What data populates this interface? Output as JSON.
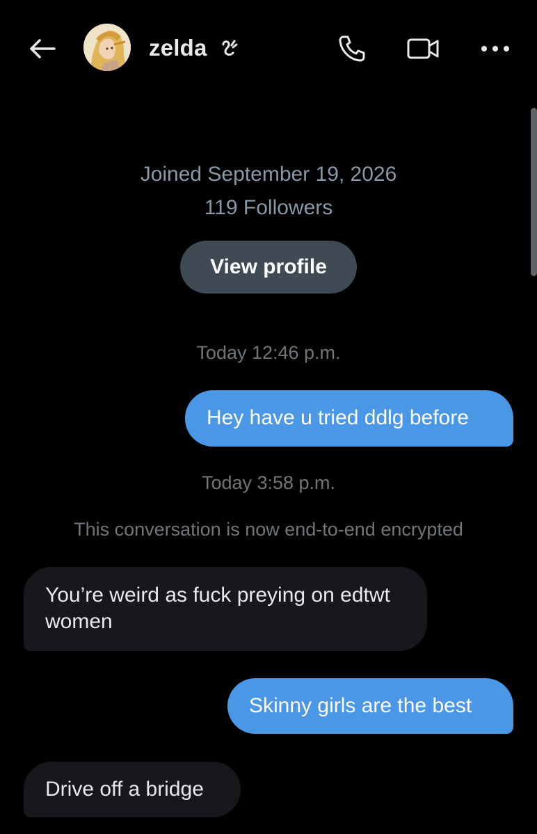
{
  "header": {
    "contact_name": "zelda",
    "icons": {
      "back": "back-arrow-icon",
      "phone": "phone-icon",
      "video": "video-camera-icon",
      "more": "more-options-icon"
    }
  },
  "profile": {
    "joined": "Joined September 19, 2026",
    "followers": "119 Followers",
    "view_profile_label": "View profile"
  },
  "conversation": {
    "timestamp_1": "Today 12:46 p.m.",
    "timestamp_2": "Today 3:58 p.m.",
    "encryption_notice": "This conversation is now end-to-end encrypted",
    "messages": [
      {
        "direction": "sent",
        "text": "Hey have u tried ddlg before"
      },
      {
        "direction": "received",
        "text": "You’re weird as fuck preying on edtwt women"
      },
      {
        "direction": "sent",
        "text": "Skinny girls are the best"
      },
      {
        "direction": "received",
        "text": "Drive off a bridge"
      }
    ]
  },
  "colors": {
    "background": "#000000",
    "sent_bubble": "#4a97e6",
    "received_bubble": "#16181c",
    "button": "#3f4a55",
    "muted_text": "#71767b"
  }
}
